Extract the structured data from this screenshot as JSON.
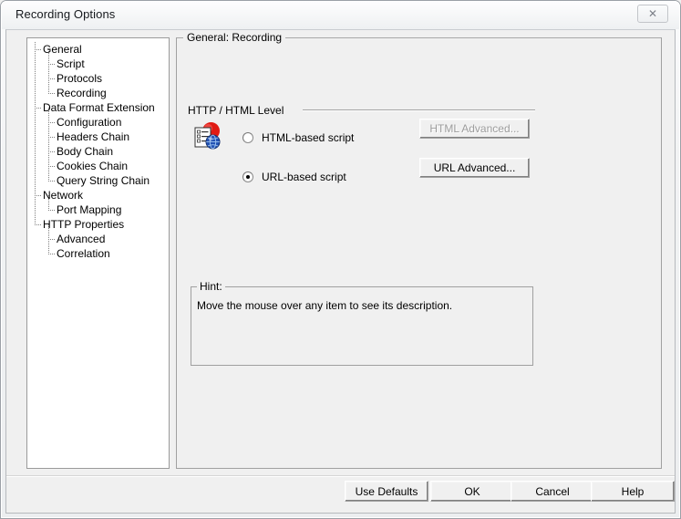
{
  "window": {
    "title": "Recording Options",
    "close_glyph": "✕"
  },
  "tree": {
    "items": [
      {
        "label": "General",
        "level": 0
      },
      {
        "label": "Script",
        "level": 1
      },
      {
        "label": "Protocols",
        "level": 1
      },
      {
        "label": "Recording",
        "level": 1
      },
      {
        "label": "Data Format Extension",
        "level": 0
      },
      {
        "label": "Configuration",
        "level": 1
      },
      {
        "label": "Headers Chain",
        "level": 1
      },
      {
        "label": "Body Chain",
        "level": 1
      },
      {
        "label": "Cookies Chain",
        "level": 1
      },
      {
        "label": "Query String Chain",
        "level": 1
      },
      {
        "label": "Network",
        "level": 0
      },
      {
        "label": "Port Mapping",
        "level": 1
      },
      {
        "label": "HTTP Properties",
        "level": 0
      },
      {
        "label": "Advanced",
        "level": 1
      },
      {
        "label": "Correlation",
        "level": 1
      }
    ]
  },
  "main": {
    "group_label": "General: Recording",
    "section_label": "HTTP / HTML Level",
    "icon_name": "recording-html-globe-icon",
    "options": [
      {
        "label": "HTML-based script",
        "selected": false
      },
      {
        "label": "URL-based script",
        "selected": true
      }
    ],
    "buttons": [
      {
        "label": "HTML Advanced...",
        "enabled": false
      },
      {
        "label": "URL Advanced...",
        "enabled": true
      }
    ]
  },
  "hint": {
    "label": "Hint:",
    "text": "Move the mouse over any item to see its description."
  },
  "footer": {
    "buttons": [
      {
        "label": "Use Defaults"
      },
      {
        "label": "OK"
      },
      {
        "label": "Cancel"
      },
      {
        "label": "Help"
      }
    ]
  },
  "colors": {
    "dialog_face": "#f0f0f0",
    "tree_background": "#ffffff",
    "text": "#000000",
    "disabled_text": "#9c9c9c",
    "icon_red": "#e01b14",
    "icon_blue": "#2353b5",
    "border": "#a0a0a0"
  }
}
